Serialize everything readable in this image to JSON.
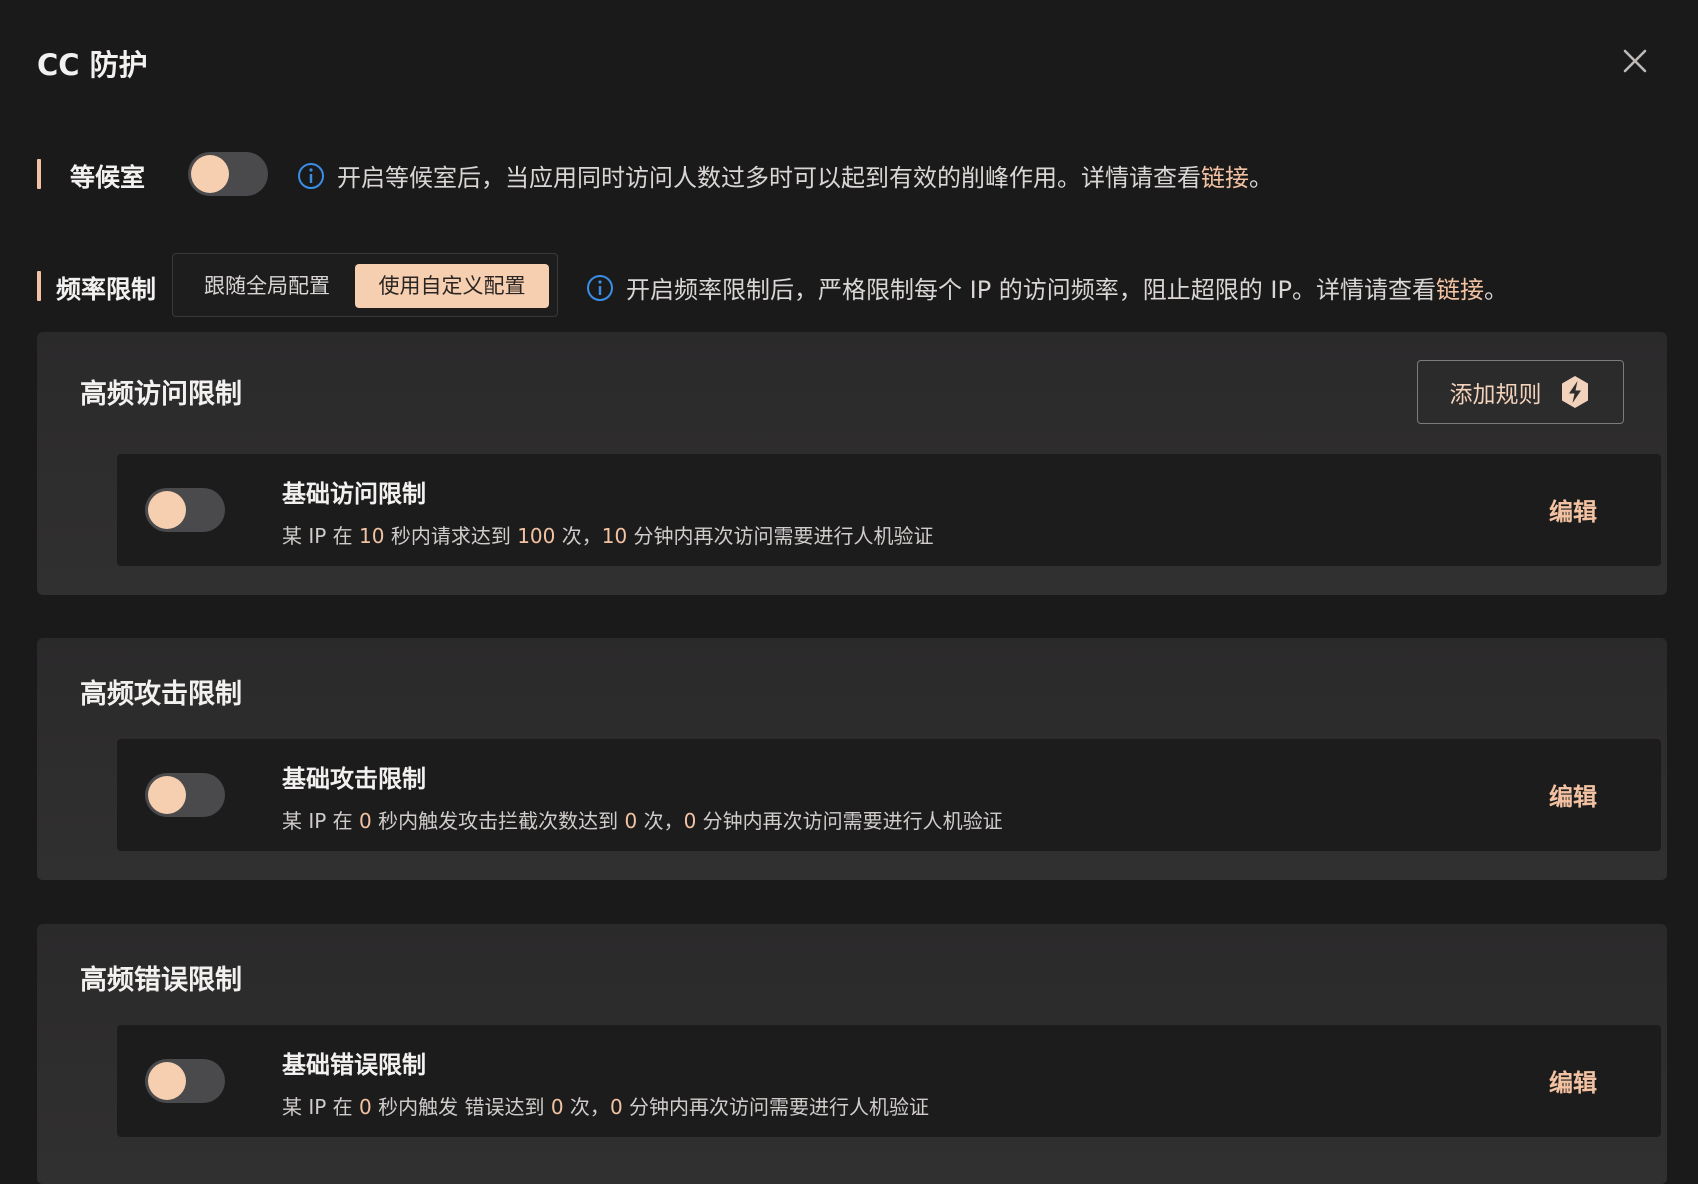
{
  "dialog": {
    "title": "CC 防护",
    "close_icon": "close-icon"
  },
  "waiting_room": {
    "label": "等候室",
    "enabled": false,
    "info_text": "开启等候室后，当应用同时访问人数过多时可以起到有效的削峰作用。详情请查看",
    "link_text": "链接",
    "info_suffix": "。"
  },
  "rate_limit": {
    "label": "频率限制",
    "options": [
      "跟随全局配置",
      "使用自定义配置"
    ],
    "selected": "使用自定义配置",
    "info_text": "开启频率限制后，严格限制每个 IP 的访问频率，阻止超限的 IP。详情请查看",
    "link_text": "链接",
    "info_suffix": "。"
  },
  "sections": [
    {
      "title": "高频访问限制",
      "add_rule_label": "添加规则",
      "rule": {
        "name": "基础访问限制",
        "enabled": false,
        "desc": {
          "p1": "某 IP 在 ",
          "n1": "10",
          "p2": " 秒内请求达到 ",
          "n2": "100",
          "p3": " 次，",
          "n3": "10",
          "p4": " 分钟内再次访问需要进行人机验证"
        },
        "edit_label": "编辑"
      }
    },
    {
      "title": "高频攻击限制",
      "rule": {
        "name": "基础攻击限制",
        "enabled": false,
        "desc": {
          "p1": "某 IP 在 ",
          "n1": "0",
          "p2": " 秒内触发攻击拦截次数达到 ",
          "n2": "0",
          "p3": " 次，",
          "n3": "0",
          "p4": " 分钟内再次访问需要进行人机验证"
        },
        "edit_label": "编辑"
      }
    },
    {
      "title": "高频错误限制",
      "rule": {
        "name": "基础错误限制",
        "enabled": false,
        "desc": {
          "p1": "某 IP 在 ",
          "n1": "0",
          "p2": " 秒内触发 错误达到 ",
          "n2": "0",
          "p3": " 次，",
          "n3": "0",
          "p4": " 分钟内再次访问需要进行人机验证"
        },
        "edit_label": "编辑"
      }
    }
  ],
  "colors": {
    "accent": "#f2c2a2",
    "toggle_knob": "#f6cfb1",
    "info_icon": "#3a8ee6",
    "background": "#1b1a1b"
  }
}
